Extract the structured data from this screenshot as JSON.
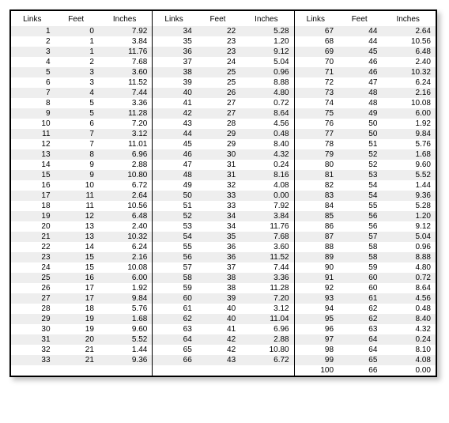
{
  "headers": {
    "links": "Links",
    "feet": "Feet",
    "inches": "Inches"
  },
  "chart_data": {
    "type": "table",
    "title": "",
    "columns": [
      "Links",
      "Feet",
      "Inches"
    ],
    "rows": [
      {
        "links": 1,
        "feet": 0,
        "inches": 7.92
      },
      {
        "links": 2,
        "feet": 1,
        "inches": 3.84
      },
      {
        "links": 3,
        "feet": 1,
        "inches": 11.76
      },
      {
        "links": 4,
        "feet": 2,
        "inches": 7.68
      },
      {
        "links": 5,
        "feet": 3,
        "inches": 3.6
      },
      {
        "links": 6,
        "feet": 3,
        "inches": 11.52
      },
      {
        "links": 7,
        "feet": 4,
        "inches": 7.44
      },
      {
        "links": 8,
        "feet": 5,
        "inches": 3.36
      },
      {
        "links": 9,
        "feet": 5,
        "inches": 11.28
      },
      {
        "links": 10,
        "feet": 6,
        "inches": 7.2
      },
      {
        "links": 11,
        "feet": 7,
        "inches": 3.12
      },
      {
        "links": 12,
        "feet": 7,
        "inches": 11.01
      },
      {
        "links": 13,
        "feet": 8,
        "inches": 6.96
      },
      {
        "links": 14,
        "feet": 9,
        "inches": 2.88
      },
      {
        "links": 15,
        "feet": 9,
        "inches": 10.8
      },
      {
        "links": 16,
        "feet": 10,
        "inches": 6.72
      },
      {
        "links": 17,
        "feet": 11,
        "inches": 2.64
      },
      {
        "links": 18,
        "feet": 11,
        "inches": 10.56
      },
      {
        "links": 19,
        "feet": 12,
        "inches": 6.48
      },
      {
        "links": 20,
        "feet": 13,
        "inches": 2.4
      },
      {
        "links": 21,
        "feet": 13,
        "inches": 10.32
      },
      {
        "links": 22,
        "feet": 14,
        "inches": 6.24
      },
      {
        "links": 23,
        "feet": 15,
        "inches": 2.16
      },
      {
        "links": 24,
        "feet": 15,
        "inches": 10.08
      },
      {
        "links": 25,
        "feet": 16,
        "inches": 6.0
      },
      {
        "links": 26,
        "feet": 17,
        "inches": 1.92
      },
      {
        "links": 27,
        "feet": 17,
        "inches": 9.84
      },
      {
        "links": 28,
        "feet": 18,
        "inches": 5.76
      },
      {
        "links": 29,
        "feet": 19,
        "inches": 1.68
      },
      {
        "links": 30,
        "feet": 19,
        "inches": 9.6
      },
      {
        "links": 31,
        "feet": 20,
        "inches": 5.52
      },
      {
        "links": 32,
        "feet": 21,
        "inches": 1.44
      },
      {
        "links": 33,
        "feet": 21,
        "inches": 9.36
      },
      {
        "links": 34,
        "feet": 22,
        "inches": 5.28
      },
      {
        "links": 35,
        "feet": 23,
        "inches": 1.2
      },
      {
        "links": 36,
        "feet": 23,
        "inches": 9.12
      },
      {
        "links": 37,
        "feet": 24,
        "inches": 5.04
      },
      {
        "links": 38,
        "feet": 25,
        "inches": 0.96
      },
      {
        "links": 39,
        "feet": 25,
        "inches": 8.88
      },
      {
        "links": 40,
        "feet": 26,
        "inches": 4.8
      },
      {
        "links": 41,
        "feet": 27,
        "inches": 0.72
      },
      {
        "links": 42,
        "feet": 27,
        "inches": 8.64
      },
      {
        "links": 43,
        "feet": 28,
        "inches": 4.56
      },
      {
        "links": 44,
        "feet": 29,
        "inches": 0.48
      },
      {
        "links": 45,
        "feet": 29,
        "inches": 8.4
      },
      {
        "links": 46,
        "feet": 30,
        "inches": 4.32
      },
      {
        "links": 47,
        "feet": 31,
        "inches": 0.24
      },
      {
        "links": 48,
        "feet": 31,
        "inches": 8.16
      },
      {
        "links": 49,
        "feet": 32,
        "inches": 4.08
      },
      {
        "links": 50,
        "feet": 33,
        "inches": 0.0
      },
      {
        "links": 51,
        "feet": 33,
        "inches": 7.92
      },
      {
        "links": 52,
        "feet": 34,
        "inches": 3.84
      },
      {
        "links": 53,
        "feet": 34,
        "inches": 11.76
      },
      {
        "links": 54,
        "feet": 35,
        "inches": 7.68
      },
      {
        "links": 55,
        "feet": 36,
        "inches": 3.6
      },
      {
        "links": 56,
        "feet": 36,
        "inches": 11.52
      },
      {
        "links": 57,
        "feet": 37,
        "inches": 7.44
      },
      {
        "links": 58,
        "feet": 38,
        "inches": 3.36
      },
      {
        "links": 59,
        "feet": 38,
        "inches": 11.28
      },
      {
        "links": 60,
        "feet": 39,
        "inches": 7.2
      },
      {
        "links": 61,
        "feet": 40,
        "inches": 3.12
      },
      {
        "links": 62,
        "feet": 40,
        "inches": 11.04
      },
      {
        "links": 63,
        "feet": 41,
        "inches": 6.96
      },
      {
        "links": 64,
        "feet": 42,
        "inches": 2.88
      },
      {
        "links": 65,
        "feet": 42,
        "inches": 10.8
      },
      {
        "links": 66,
        "feet": 43,
        "inches": 6.72
      },
      {
        "links": 67,
        "feet": 44,
        "inches": 2.64
      },
      {
        "links": 68,
        "feet": 44,
        "inches": 10.56
      },
      {
        "links": 69,
        "feet": 45,
        "inches": 6.48
      },
      {
        "links": 70,
        "feet": 46,
        "inches": 2.4
      },
      {
        "links": 71,
        "feet": 46,
        "inches": 10.32
      },
      {
        "links": 72,
        "feet": 47,
        "inches": 6.24
      },
      {
        "links": 73,
        "feet": 48,
        "inches": 2.16
      },
      {
        "links": 74,
        "feet": 48,
        "inches": 10.08
      },
      {
        "links": 75,
        "feet": 49,
        "inches": 6.0
      },
      {
        "links": 76,
        "feet": 50,
        "inches": 1.92
      },
      {
        "links": 77,
        "feet": 50,
        "inches": 9.84
      },
      {
        "links": 78,
        "feet": 51,
        "inches": 5.76
      },
      {
        "links": 79,
        "feet": 52,
        "inches": 1.68
      },
      {
        "links": 80,
        "feet": 52,
        "inches": 9.6
      },
      {
        "links": 81,
        "feet": 53,
        "inches": 5.52
      },
      {
        "links": 82,
        "feet": 54,
        "inches": 1.44
      },
      {
        "links": 83,
        "feet": 54,
        "inches": 9.36
      },
      {
        "links": 84,
        "feet": 55,
        "inches": 5.28
      },
      {
        "links": 85,
        "feet": 56,
        "inches": 1.2
      },
      {
        "links": 86,
        "feet": 56,
        "inches": 9.12
      },
      {
        "links": 87,
        "feet": 57,
        "inches": 5.04
      },
      {
        "links": 88,
        "feet": 58,
        "inches": 0.96
      },
      {
        "links": 89,
        "feet": 58,
        "inches": 8.88
      },
      {
        "links": 90,
        "feet": 59,
        "inches": 4.8
      },
      {
        "links": 91,
        "feet": 60,
        "inches": 0.72
      },
      {
        "links": 92,
        "feet": 60,
        "inches": 8.64
      },
      {
        "links": 93,
        "feet": 61,
        "inches": 4.56
      },
      {
        "links": 94,
        "feet": 62,
        "inches": 0.48
      },
      {
        "links": 95,
        "feet": 62,
        "inches": 8.4
      },
      {
        "links": 96,
        "feet": 63,
        "inches": 4.32
      },
      {
        "links": 97,
        "feet": 64,
        "inches": 0.24
      },
      {
        "links": 98,
        "feet": 64,
        "inches": 8.1
      },
      {
        "links": 99,
        "feet": 65,
        "inches": 4.08
      },
      {
        "links": 100,
        "feet": 66,
        "inches": 0.0
      }
    ]
  }
}
